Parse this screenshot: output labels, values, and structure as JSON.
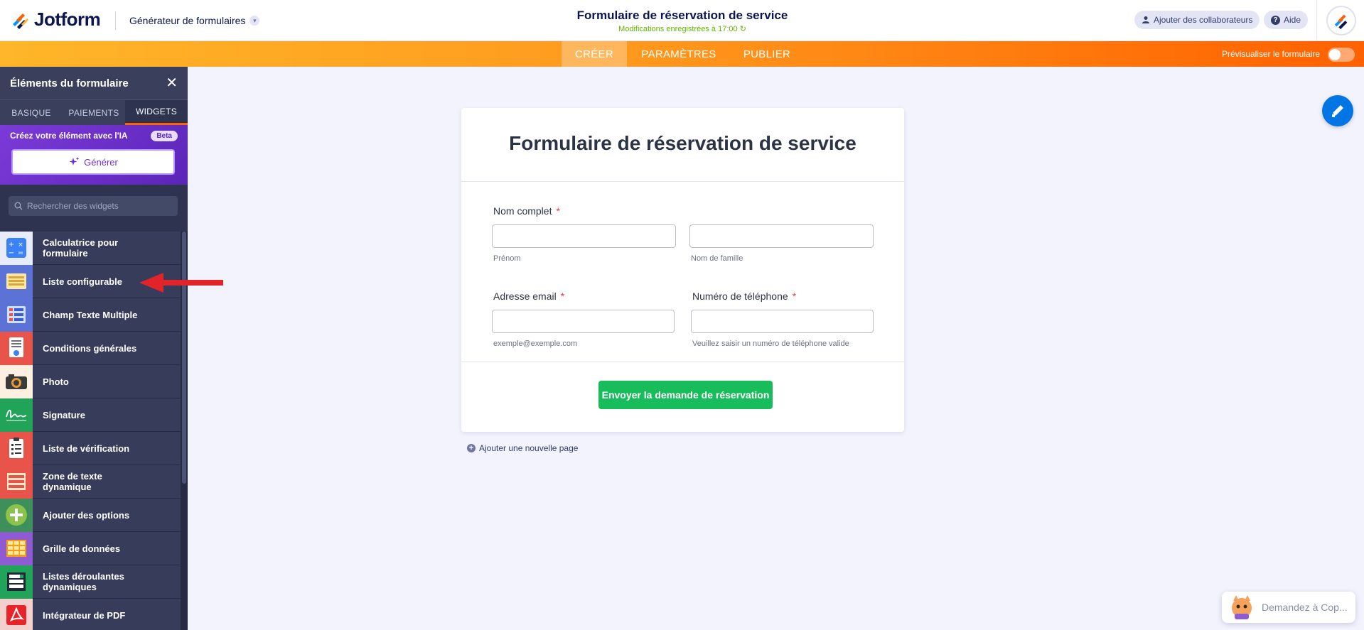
{
  "header": {
    "logo_text": "Jotform",
    "builder_label": "Générateur de formulaires",
    "form_title": "Formulaire de réservation de service",
    "saved_status": "Modifications enregistrées à 17:00",
    "collaborators_label": "Ajouter des collaborateurs",
    "help_label": "Aide"
  },
  "nav": {
    "tabs": [
      {
        "label": "CRÉER",
        "active": true
      },
      {
        "label": "PARAMÈTRES",
        "active": false
      },
      {
        "label": "PUBLIER",
        "active": false
      }
    ],
    "preview_label": "Prévisualiser le formulaire"
  },
  "sidebar": {
    "title": "Éléments du formulaire",
    "tabs": [
      {
        "label": "BASIQUE",
        "active": false
      },
      {
        "label": "PAIEMENTS",
        "active": false
      },
      {
        "label": "WIDGETS",
        "active": true
      }
    ],
    "ai_label": "Créez votre élément avec l'IA",
    "beta_label": "Beta",
    "generate_label": "Générer",
    "search_placeholder": "Rechercher des widgets",
    "items": [
      {
        "label": "Calculatrice pour formulaire",
        "icon": "calculator-icon",
        "color": "#3b82f6"
      },
      {
        "label": "Liste configurable",
        "icon": "configurable-list-icon",
        "color": "#5b73d6"
      },
      {
        "label": "Champ Texte Multiple",
        "icon": "multiple-text-icon",
        "color": "#5b73d6"
      },
      {
        "label": "Conditions générales",
        "icon": "terms-icon",
        "color": "#e8534a"
      },
      {
        "label": "Photo",
        "icon": "camera-icon",
        "color": "#e8534a"
      },
      {
        "label": "Signature",
        "icon": "signature-icon",
        "color": "#22a35a"
      },
      {
        "label": "Liste de vérification",
        "icon": "checklist-icon",
        "color": "#e8534a"
      },
      {
        "label": "Zone de texte dynamique",
        "icon": "dynamic-text-icon",
        "color": "#e8534a"
      },
      {
        "label": "Ajouter des options",
        "icon": "add-options-icon",
        "color": "#7cb342"
      },
      {
        "label": "Grille de données",
        "icon": "data-grid-icon",
        "color": "#8e5bd4"
      },
      {
        "label": "Listes déroulantes dynamiques",
        "icon": "dropdown-list-icon",
        "color": "#22a35a"
      },
      {
        "label": "Intégrateur de PDF",
        "icon": "pdf-icon",
        "color": "#e8534a"
      }
    ]
  },
  "form": {
    "title": "Formulaire de réservation de service",
    "fields": {
      "name_label": "Nom complet",
      "first_sub": "Prénom",
      "last_sub": "Nom de famille",
      "email_label": "Adresse email",
      "email_sub": "exemple@exemple.com",
      "phone_label": "Numéro de téléphone",
      "phone_sub": "Veuillez saisir un numéro de téléphone valide",
      "required_mark": "*"
    },
    "submit_label": "Envoyer la demande de réservation",
    "add_page_label": "Ajouter une nouvelle page"
  },
  "copilot_label": "Demandez à Cop...",
  "colors": {
    "accent_orange": "#ff6100",
    "submit_green": "#18bd5b",
    "fab_blue": "#0075e3",
    "annotation_arrow": "#e0242a"
  }
}
